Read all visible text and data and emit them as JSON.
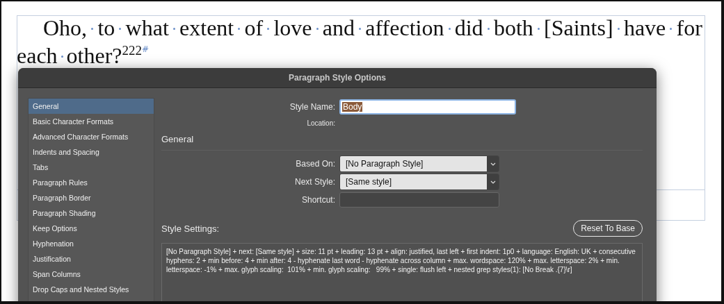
{
  "document": {
    "lines": [
      "Oho, to what extent of love and affection did both [Saints] have for",
      "each other?"
    ],
    "footnote_ref": "222",
    "end_mark": "#"
  },
  "dialog": {
    "title": "Paragraph Style Options",
    "sidebar": {
      "items": [
        {
          "label": "General",
          "selected": true
        },
        {
          "label": "Basic Character Formats",
          "selected": false
        },
        {
          "label": "Advanced Character Formats",
          "selected": false
        },
        {
          "label": "Indents and Spacing",
          "selected": false
        },
        {
          "label": "Tabs",
          "selected": false
        },
        {
          "label": "Paragraph Rules",
          "selected": false
        },
        {
          "label": "Paragraph Border",
          "selected": false
        },
        {
          "label": "Paragraph Shading",
          "selected": false
        },
        {
          "label": "Keep Options",
          "selected": false
        },
        {
          "label": "Hyphenation",
          "selected": false
        },
        {
          "label": "Justification",
          "selected": false
        },
        {
          "label": "Span Columns",
          "selected": false
        },
        {
          "label": "Drop Caps and Nested Styles",
          "selected": false
        }
      ]
    },
    "style_name": {
      "label": "Style Name:",
      "value": "Body"
    },
    "location": {
      "label": "Location:"
    },
    "section_title": "General",
    "fields": [
      {
        "kind": "select",
        "label": "Based On:",
        "value": "[No Paragraph Style]"
      },
      {
        "kind": "select",
        "label": "Next Style:",
        "value": "[Same style]"
      },
      {
        "kind": "text",
        "label": "Shortcut:"
      }
    ],
    "style_settings": {
      "label": "Style Settings:",
      "reset_button": "Reset To Base",
      "text": "[No Paragraph Style] + next: [Same style] + size: 11 pt + leading: 13 pt + align: justified, last left + first indent: 1p0 + language: English: UK + consecutive hyphens: 2 + min before: 4 + min after: 4 - hyphenate last word - hyphenate across column + max. wordspace: 120% + max. letterspace: 2% + min. letterspace: -1% + max. glyph scaling:  101% + min. glyph scaling:   99% + single: flush left + nested grep styles(1): [No Break .{7}\\r]"
    }
  }
}
